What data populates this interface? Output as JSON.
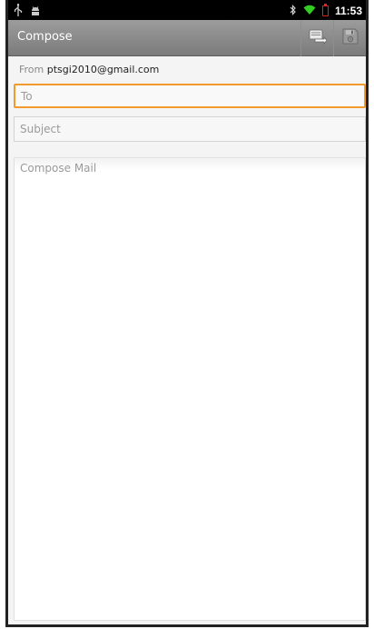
{
  "status_bar": {
    "time": "11:53",
    "icons": [
      "usb-icon",
      "android-debug-icon",
      "bluetooth-icon",
      "wifi-icon",
      "battery-low-icon"
    ],
    "battery_color": "#ee2211",
    "wifi_color": "#33cc22"
  },
  "action_bar": {
    "title": "Compose",
    "icons": [
      "send-icon",
      "save-draft-icon"
    ]
  },
  "from": {
    "label": "From",
    "email": "ptsgi2010@gmail.com"
  },
  "to_field": {
    "placeholder": "To",
    "value": ""
  },
  "subject_field": {
    "placeholder": "Subject",
    "value": ""
  },
  "body_field": {
    "placeholder": "Compose Mail",
    "value": ""
  },
  "colors": {
    "focus_border": "#f29a2e",
    "action_bar": "#8c8c8c"
  }
}
